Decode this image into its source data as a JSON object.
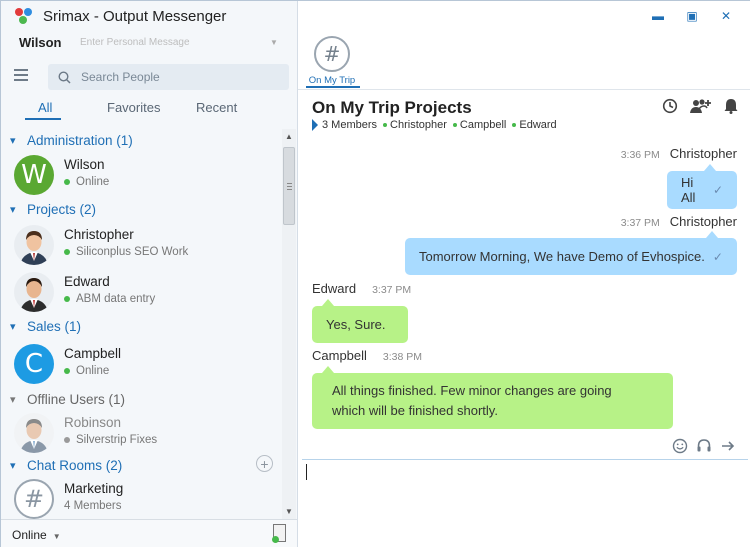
{
  "app": {
    "title": "Srimax - Output Messenger"
  },
  "user": {
    "name": "Wilson",
    "personal_message_placeholder": "Enter Personal Message"
  },
  "search": {
    "placeholder": "Search People"
  },
  "tabs": [
    {
      "label": "All",
      "active": true
    },
    {
      "label": "Favorites"
    },
    {
      "label": "Recent"
    }
  ],
  "groups": [
    {
      "label": "Administration (1)",
      "contacts": [
        {
          "name": "Wilson",
          "status": "Online",
          "avatar": "W"
        }
      ]
    },
    {
      "label": "Projects (2)",
      "contacts": [
        {
          "name": "Christopher",
          "status": "Siliconplus SEO Work"
        },
        {
          "name": "Edward",
          "status": "ABM data entry"
        }
      ]
    },
    {
      "label": "Sales (1)",
      "contacts": [
        {
          "name": "Campbell",
          "status": "Online",
          "avatar": "C"
        }
      ]
    },
    {
      "label": "Offline Users (1)",
      "contacts": [
        {
          "name": "Robinson",
          "status": "Silverstrip Fixes"
        }
      ]
    },
    {
      "label": "Chat Rooms (2)",
      "contacts": [
        {
          "name": "Marketing",
          "status": "4 Members",
          "avatar": "#"
        }
      ]
    }
  ],
  "status_bar": {
    "status": "Online"
  },
  "room_tab": {
    "label": "On My Trip",
    "icon": "#"
  },
  "chat": {
    "title": "On My Trip Projects",
    "members_count": "3 Members",
    "members": [
      "Christopher",
      "Campbell",
      "Edward"
    ],
    "messages": [
      {
        "sender": "Christopher",
        "time": "3:36 PM",
        "text": "Hi All",
        "direction": "out"
      },
      {
        "sender": "Christopher",
        "time": "3:37 PM",
        "text": "Tomorrow Morning, We have Demo of Evhospice.",
        "direction": "out"
      },
      {
        "sender": "Edward",
        "time": "3:37 PM",
        "text": "Yes, Sure.",
        "direction": "in"
      },
      {
        "sender": "Campbell",
        "time": "3:38 PM",
        "text": "All things finished. Few minor changes are going",
        "text2": "which will be finished shortly.",
        "direction": "in"
      }
    ]
  },
  "colors": {
    "accent": "#1f6fb5",
    "online": "#46b94a",
    "bubble_out": "#a9dbff",
    "bubble_in": "#b7f287"
  },
  "icons": {
    "window": [
      "minimize-icon",
      "maximize-icon",
      "close-icon"
    ],
    "header": [
      "history-icon",
      "add-member-icon",
      "notification-bell-icon"
    ],
    "compose": [
      "emoji-icon",
      "headset-icon",
      "send-arrow-icon"
    ]
  }
}
